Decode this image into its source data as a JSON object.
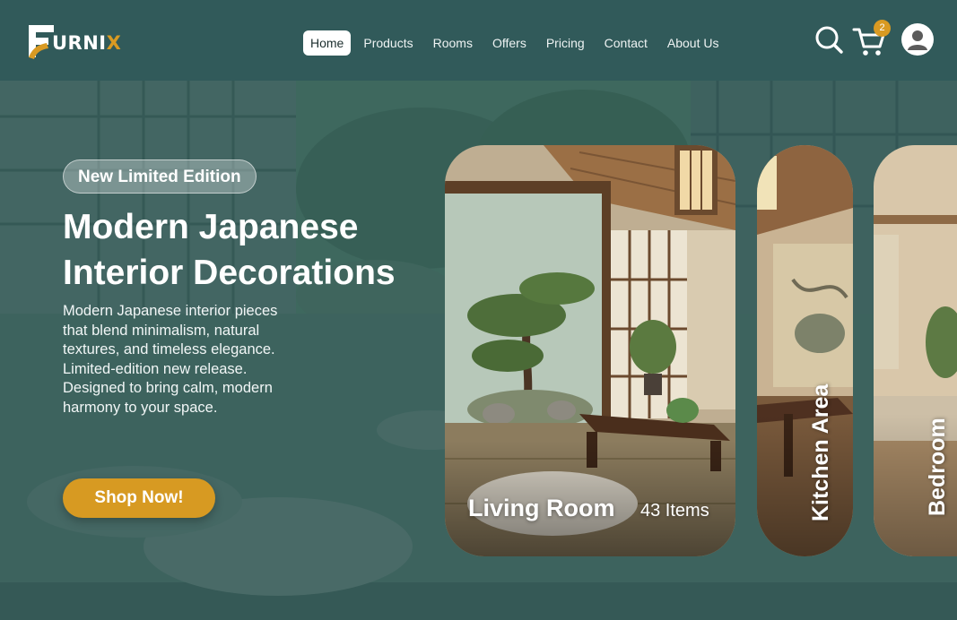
{
  "brand": {
    "name_part1": "URNIX",
    "name_part2": "X",
    "name_part1_plain": "URNI",
    "accent_color": "#d99a22"
  },
  "nav": {
    "items": [
      {
        "label": "Home",
        "active": true
      },
      {
        "label": "Products"
      },
      {
        "label": "Rooms"
      },
      {
        "label": "Offers"
      },
      {
        "label": "Pricing"
      },
      {
        "label": "Contact"
      },
      {
        "label": "About Us"
      }
    ]
  },
  "header": {
    "icons": [
      "search-icon",
      "cart-icon",
      "user-icon"
    ],
    "cart_count": "2"
  },
  "hero": {
    "badge": "New Limited Edition",
    "title": "Modern Japanese Interior Decorations",
    "description": "Modern Japanese interior pieces that blend minimalism, natural textures, and timeless elegance. Limited-edition new release. Designed to bring calm, modern harmony to your space.",
    "cta": "Shop Now!"
  },
  "rooms": [
    {
      "name": "Living Room",
      "count": "43 Items"
    },
    {
      "name": "Kitchen Area"
    },
    {
      "name": "Bedroom"
    }
  ],
  "colors": {
    "header_bg": "#315a5a",
    "cta": "#d79a22",
    "badge_bg": "rgba(255,255,255,0.30)"
  }
}
